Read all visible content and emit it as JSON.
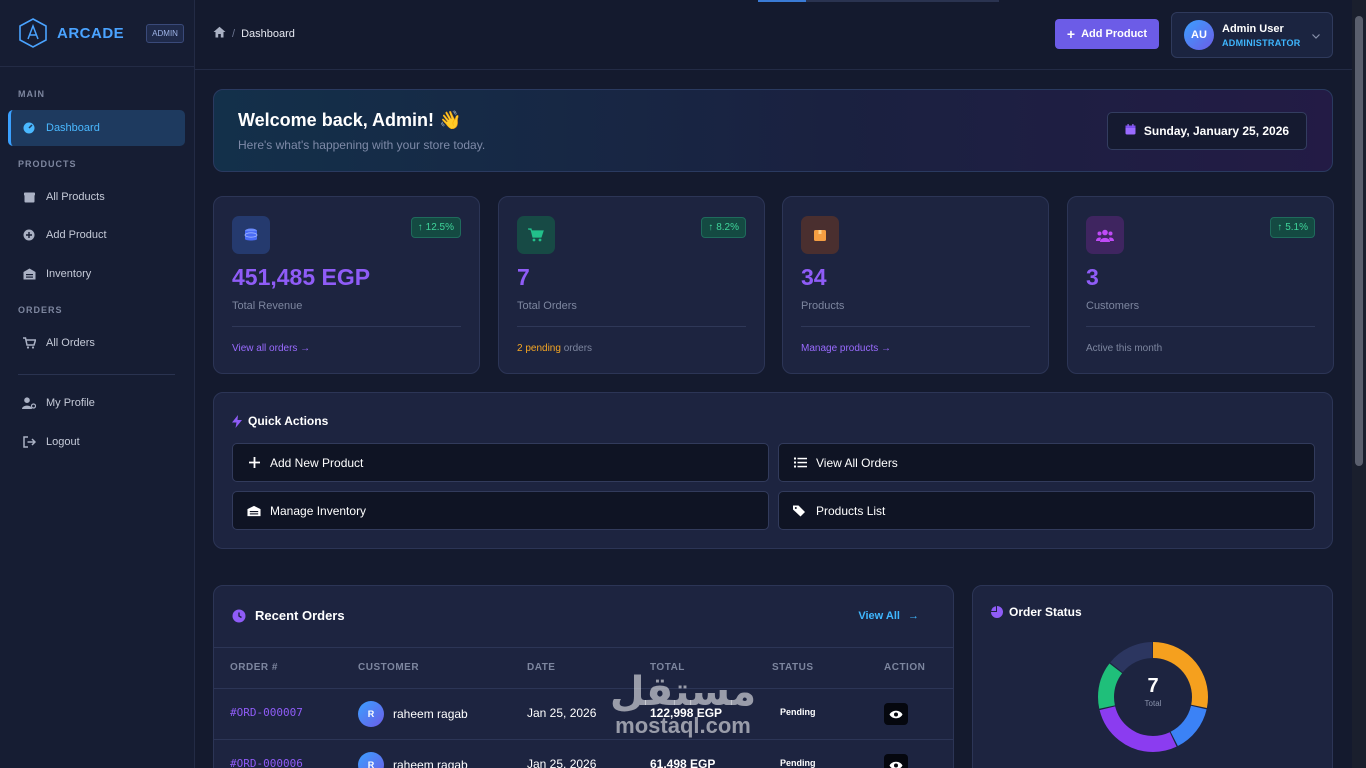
{
  "brand": {
    "name": "ARCADE",
    "badge": "ADMIN"
  },
  "sidebar": {
    "sections": {
      "main": "MAIN",
      "products": "PRODUCTS",
      "orders": "ORDERS"
    },
    "items": {
      "dashboard": "Dashboard",
      "all_products": "All Products",
      "add_product": "Add Product",
      "inventory": "Inventory",
      "all_orders": "All Orders",
      "my_profile": "My Profile",
      "logout": "Logout"
    }
  },
  "topbar": {
    "breadcrumb_current": "Dashboard",
    "add_product_label": "Add Product",
    "user": {
      "initials": "AU",
      "name": "Admin User",
      "role": "ADMINISTRATOR"
    }
  },
  "welcome": {
    "title": "Welcome back, Admin! 👋",
    "subtitle": "Here's what's happening with your store today.",
    "date": "Sunday, January 25, 2026"
  },
  "stats": [
    {
      "value": "451,485 EGP",
      "label": "Total Revenue",
      "badge": "12.5%",
      "footer": "View all orders →",
      "icon": "coins-icon",
      "color": "#4a6cf7"
    },
    {
      "value": "7",
      "label": "Total Orders",
      "badge": "8.2%",
      "footer_highlight": "2 pending",
      "footer_rest": " orders",
      "icon": "cart-icon",
      "color": "#22c08a"
    },
    {
      "value": "34",
      "label": "Products",
      "footer": "Manage products →",
      "icon": "box-icon",
      "color": "#f59e42"
    },
    {
      "value": "3",
      "label": "Customers",
      "badge": "5.1%",
      "footer": "Active this month",
      "icon": "users-icon",
      "color": "#c04af7"
    }
  ],
  "quick_actions": {
    "title": "Quick Actions",
    "items": [
      "Add New Product",
      "View All Orders",
      "Manage Inventory",
      "Products List"
    ]
  },
  "recent_orders": {
    "title": "Recent Orders",
    "view_all": "View All",
    "columns": [
      "ORDER #",
      "CUSTOMER",
      "DATE",
      "TOTAL",
      "STATUS",
      "ACTION"
    ],
    "rows": [
      {
        "id": "#ORD-000007",
        "initial": "R",
        "customer": "raheem ragab",
        "date": "Jan 25, 2026",
        "total": "122,998 EGP",
        "status": "Pending"
      },
      {
        "id": "#ORD-000006",
        "initial": "R",
        "customer": "raheem ragab",
        "date": "Jan 25, 2026",
        "total": "61,498 EGP",
        "status": "Pending"
      }
    ]
  },
  "order_status": {
    "title": "Order Status",
    "total": "7",
    "total_label": "Total",
    "segments": [
      {
        "value": 2,
        "color": "#f5a01e"
      },
      {
        "value": 1,
        "color": "#3b82f6"
      },
      {
        "value": 2,
        "color": "#8b3cf0"
      },
      {
        "value": 1,
        "color": "#1fbf7a"
      },
      {
        "value": 1,
        "color": "#2c3660"
      }
    ]
  },
  "watermark": {
    "arabic": "مستقل",
    "latin": "mostaql.com"
  },
  "colors": {
    "accent": "#6c5ce7",
    "link": "#3fb7ff",
    "value": "#8f5cf7"
  }
}
